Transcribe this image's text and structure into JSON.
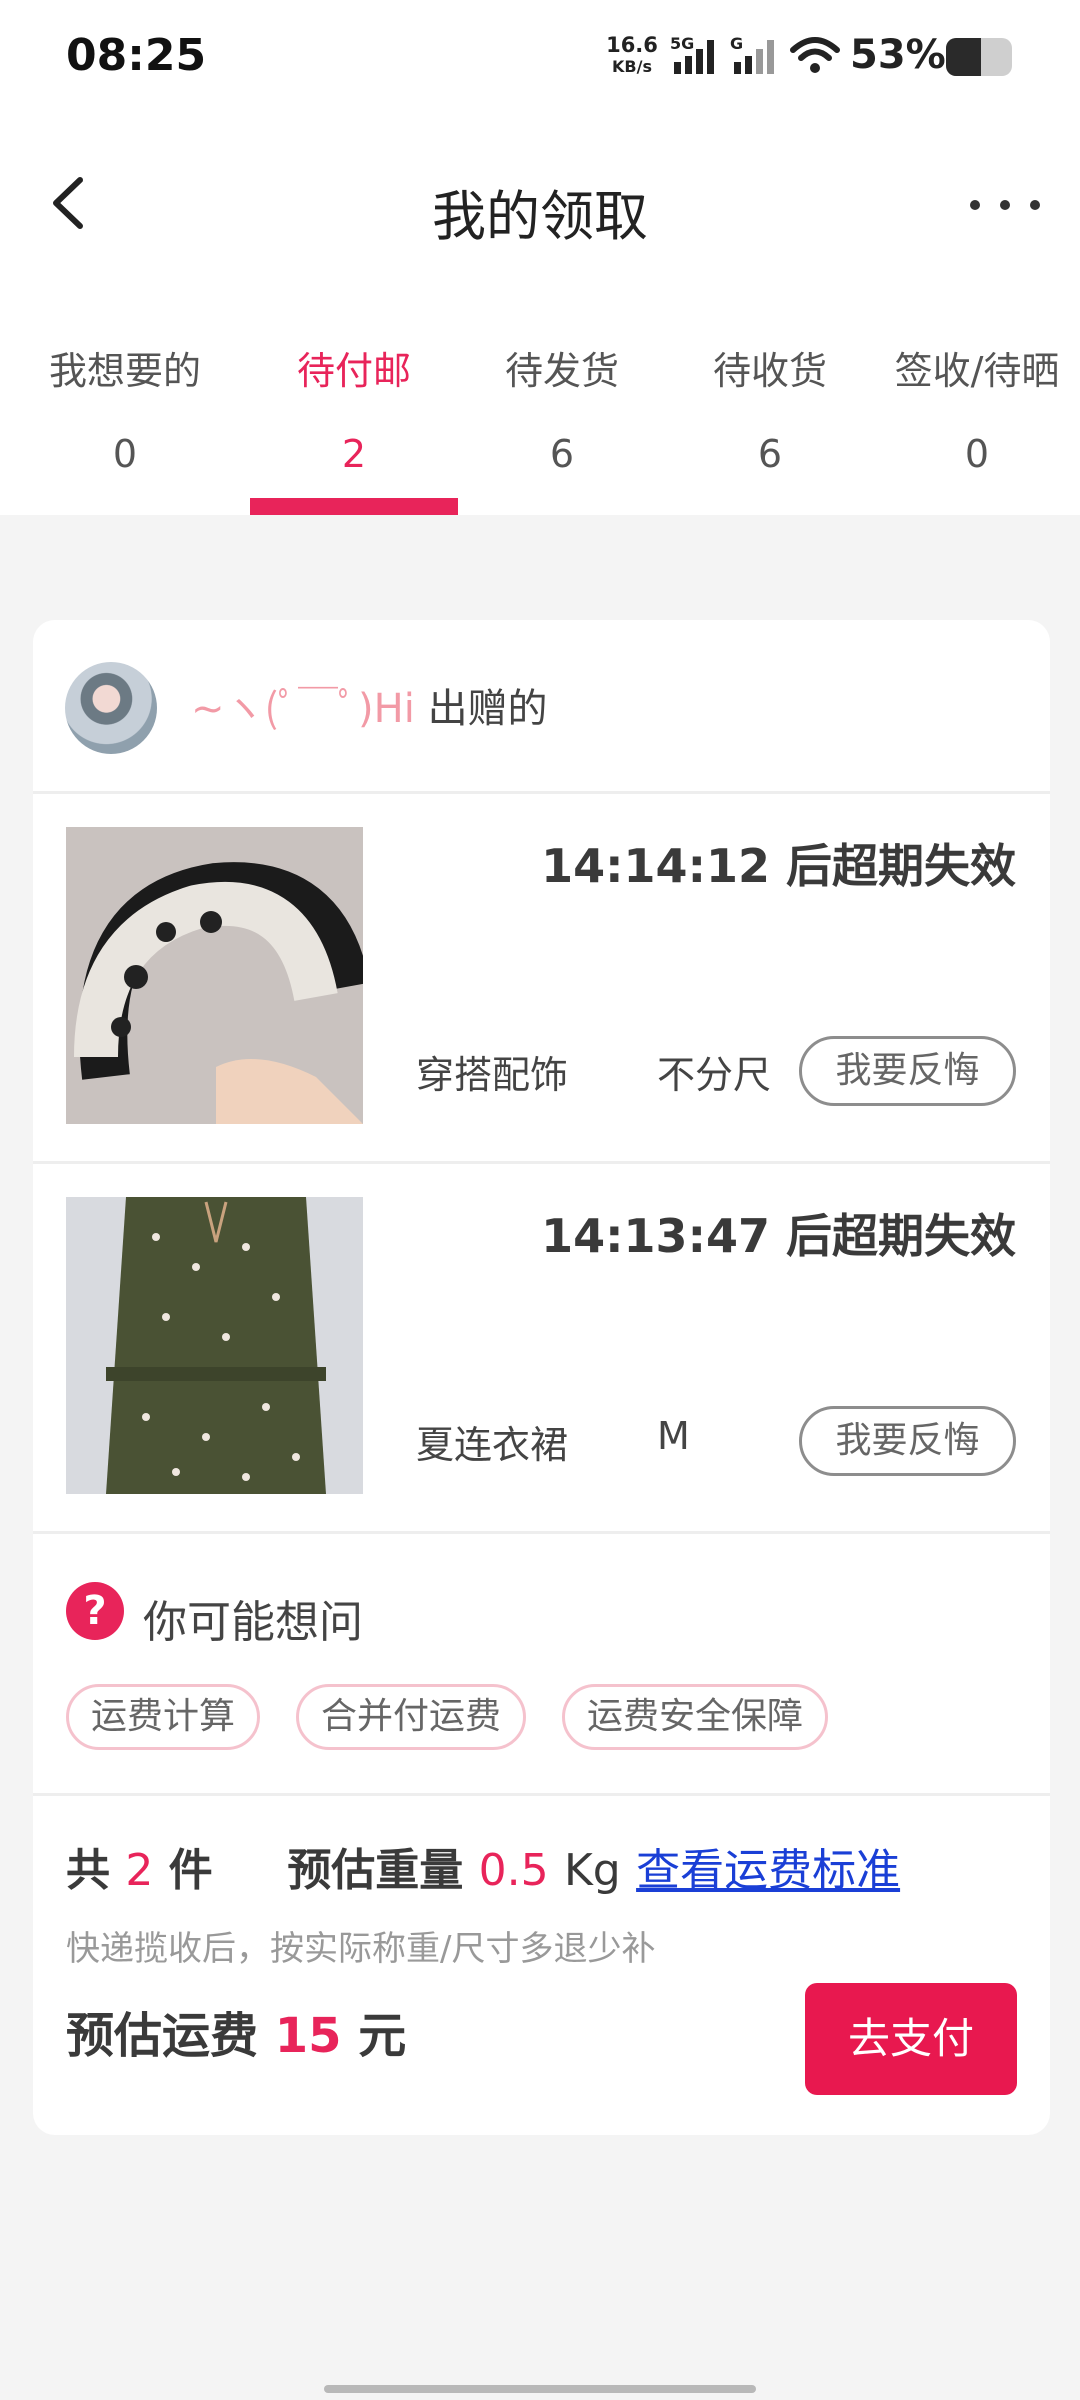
{
  "status_bar": {
    "time": "08:25",
    "net_speed": "16.6",
    "net_unit": "KB/s",
    "signal1_tag": "5G",
    "signal2_tag": "G",
    "battery_percent": "53%",
    "battery_level": 0.53
  },
  "nav": {
    "title": "我的领取",
    "back_icon": "chevron-left-icon",
    "more_icon": "more-horizontal-icon"
  },
  "tabs": [
    {
      "label": "我想要的",
      "count": "0"
    },
    {
      "label": "待付邮",
      "count": "2",
      "active": true
    },
    {
      "label": "待发货",
      "count": "6"
    },
    {
      "label": "待收货",
      "count": "6"
    },
    {
      "label": "签收/待晒",
      "count": "0"
    }
  ],
  "accent_color": "#e8245a",
  "order": {
    "seller_nick": "~ヽ(ﾟ￣ﾟ)Hi",
    "seller_suffix": "出赠的",
    "items": [
      {
        "countdown": "14:14:12 后超期失效",
        "category": "穿搭配饰",
        "size": "不分尺",
        "regret_label": "我要反悔"
      },
      {
        "countdown": "14:13:47 后超期失效",
        "category": "夏连衣裙",
        "size": "M",
        "regret_label": "我要反悔"
      }
    ]
  },
  "faq": {
    "title": "你可能想问",
    "icon": "question-icon",
    "chips": [
      "运费计算",
      "合并付运费",
      "运费安全保障"
    ]
  },
  "summary": {
    "total_prefix": "共",
    "total_count": "2",
    "total_suffix": "件",
    "weight_label": "预估重量",
    "weight_value": "0.5",
    "weight_unit": "Kg",
    "link_text": "查看运费标准",
    "note": "快递揽收后，按实际称重/尺寸多退少补",
    "fee_label": "预估运费",
    "fee_value": "15",
    "fee_unit": "元",
    "pay_label": "去支付"
  }
}
